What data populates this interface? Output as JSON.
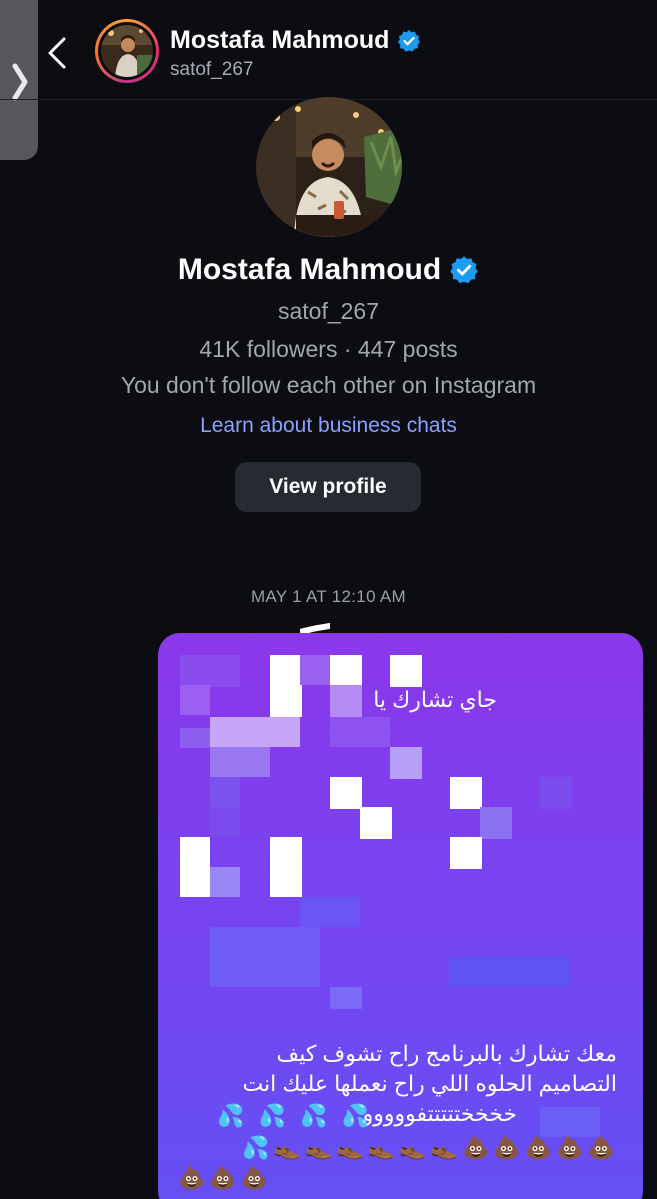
{
  "header": {
    "name": "Mostafa Mahmoud",
    "username": "satof_267"
  },
  "profile": {
    "name": "Mostafa Mahmoud",
    "username": "satof_267",
    "stats": "41K followers · 447 posts",
    "follow_status": "You don't follow each other on Instagram",
    "learn_link": "Learn about business chats",
    "view_profile_label": "View profile"
  },
  "chat": {
    "timestamp": "MAY 1 AT 12:10 AM",
    "message": {
      "visible_lines": [
        "جاي تشارك يا",
        "معك تشارك بالبرنامج راح تشوف كيف",
        "التصاميم الحلوه اللي راح نعملها عليك انت",
        "خخخختتتتتفووووو"
      ],
      "emoji_row_1": "💦 💦 💦 💦",
      "emoji_row_2": "💦👞👞👞👞👞👞💩💩💩💩💩",
      "emoji_row_3": "💩💩💩"
    }
  },
  "colors": {
    "background": "#0b0d12",
    "verified": "#1d9bf0",
    "link": "#8aa1ff",
    "bubble_top": "#8b37ea",
    "bubble_bottom": "#6450f5"
  }
}
